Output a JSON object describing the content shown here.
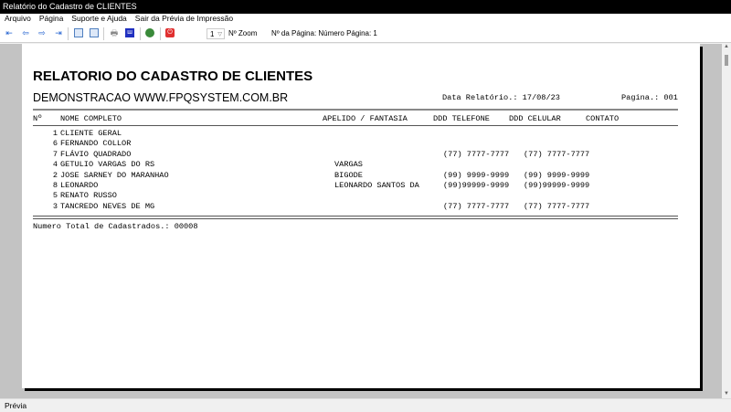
{
  "window": {
    "title": "Relatório do Cadastro de CLIENTES"
  },
  "menu": [
    "Arquivo",
    "Página",
    "Suporte e Ajuda",
    "Sair da Prévia de Impressão"
  ],
  "toolbar": {
    "zoom_value": "1",
    "zoom_label": "Nº Zoom",
    "page_label": "Nº da Página: Número Página: 1"
  },
  "report": {
    "title": "RELATORIO DO CADASTRO DE CLIENTES",
    "subtitle": "DEMONSTRACAO WWW.FPQSYSTEM.COM.BR",
    "date": "Data Relatório.: 17/08/23",
    "page": "Pagina.: 001",
    "headers": {
      "num": "Nº",
      "name": "NOME COMPLETO",
      "nick": "APELIDO / FANTASIA",
      "phone": "DDD TELEFONE",
      "cell": "DDD CELULAR",
      "contact": "CONTATO"
    },
    "rows": [
      {
        "num": "1",
        "name": "CLIENTE GERAL",
        "nick": "",
        "phone": "",
        "cell": ""
      },
      {
        "num": "6",
        "name": "FERNANDO COLLOR",
        "nick": "",
        "phone": "",
        "cell": ""
      },
      {
        "num": "7",
        "name": "FLÁVIO QUADRADO",
        "nick": "",
        "phone": "(77) 7777-7777",
        "cell": "(77) 7777-7777"
      },
      {
        "num": "4",
        "name": "GETULIO VARGAS DO RS",
        "nick": "VARGAS",
        "phone": "",
        "cell": ""
      },
      {
        "num": "2",
        "name": "JOSE SARNEY DO MARANHAO",
        "nick": "BIGODE",
        "phone": "(99) 9999-9999",
        "cell": "(99) 9999-9999"
      },
      {
        "num": "8",
        "name": "LEONARDO",
        "nick": "LEONARDO SANTOS DA",
        "phone": "(99)99999-9999",
        "cell": "(99)99999-9999"
      },
      {
        "num": "5",
        "name": "RENATO RUSSO",
        "nick": "",
        "phone": "",
        "cell": ""
      },
      {
        "num": "3",
        "name": "TANCREDO NEVES DE MG",
        "nick": "",
        "phone": "(77) 7777-7777",
        "cell": "(77) 7777-7777"
      }
    ],
    "total": "Numero Total de Cadastrados.: 00008"
  },
  "status": "Prévia"
}
